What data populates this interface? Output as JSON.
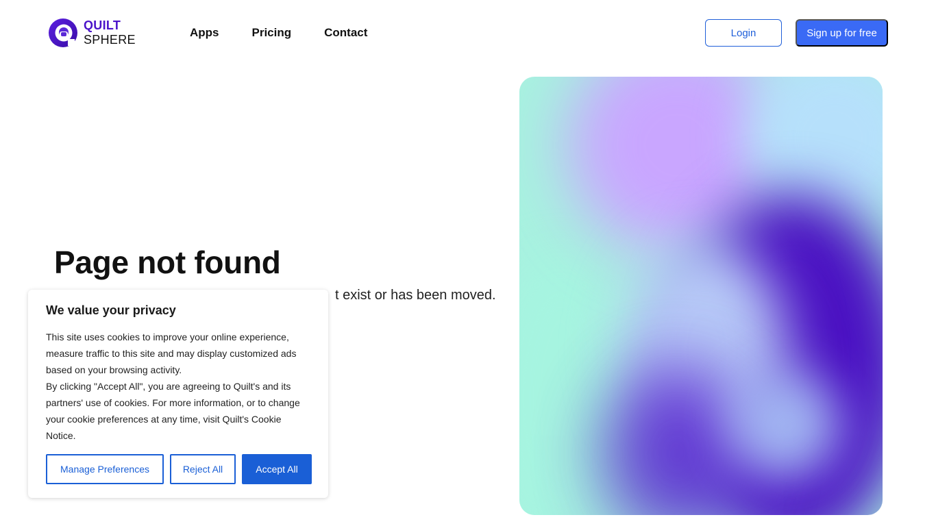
{
  "header": {
    "logo_top": "QUILT",
    "logo_bottom": "SPHERE",
    "nav": [
      {
        "label": "Apps"
      },
      {
        "label": "Pricing"
      },
      {
        "label": "Contact"
      }
    ],
    "login_label": "Login",
    "signup_label": "Sign up for free"
  },
  "main": {
    "title": "Page not found",
    "message_visible": "t exist or has been moved."
  },
  "cookie_banner": {
    "title": "We value your privacy",
    "paragraph_1": "This site uses cookies to improve your online experience, measure traffic to this site and may display customized ads based on your browsing activity.",
    "paragraph_2": "By clicking \"Accept All\", you are agreeing to Quilt's and its partners' use of cookies. For more information, or to change your cookie preferences at any time, visit Quilt's Cookie Notice.",
    "manage_label": "Manage Preferences",
    "reject_label": "Reject All",
    "accept_label": "Accept All"
  },
  "colors": {
    "brand_purple": "#4a13c9",
    "primary_blue": "#3a6af5",
    "cookie_blue": "#1a5fd6"
  }
}
